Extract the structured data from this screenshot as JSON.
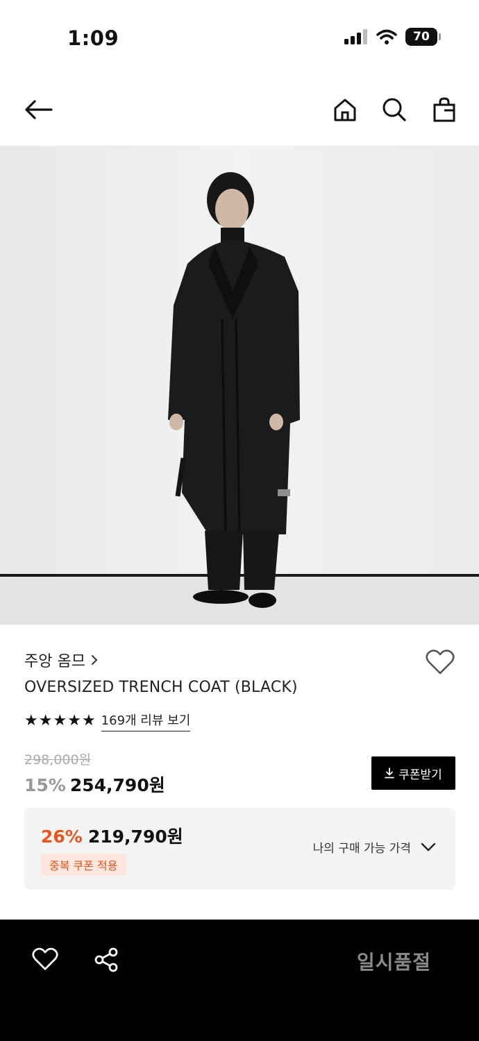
{
  "status_bar": {
    "time": "1:09",
    "battery": "70",
    "icons": [
      "signal-icon",
      "wifi-icon",
      "battery-icon"
    ]
  },
  "nav": {
    "icons": [
      "back-arrow-icon",
      "home-icon",
      "search-icon",
      "shopping-bag-icon"
    ]
  },
  "product": {
    "brand": "주앙 옴므",
    "name": "OVERSIZED TRENCH COAT (BLACK)",
    "rating_stars": 5,
    "review_link": "169개 리뷰 보기",
    "original_price": "298,000원",
    "discount": "15%",
    "price": "254,790원",
    "coupon_button": "쿠폰받기",
    "best": {
      "discount": "26%",
      "price": "219,790원",
      "badge": "중복 쿠폰 적용",
      "my_price_label": "나의 구매 가능 가격"
    }
  },
  "bottom": {
    "soldout_label": "일시품절",
    "icons": [
      "heart-icon",
      "share-icon"
    ]
  },
  "colors": {
    "accent": "#e8541c",
    "badge_bg": "#fde6de",
    "bottom_bar": "#000000"
  }
}
